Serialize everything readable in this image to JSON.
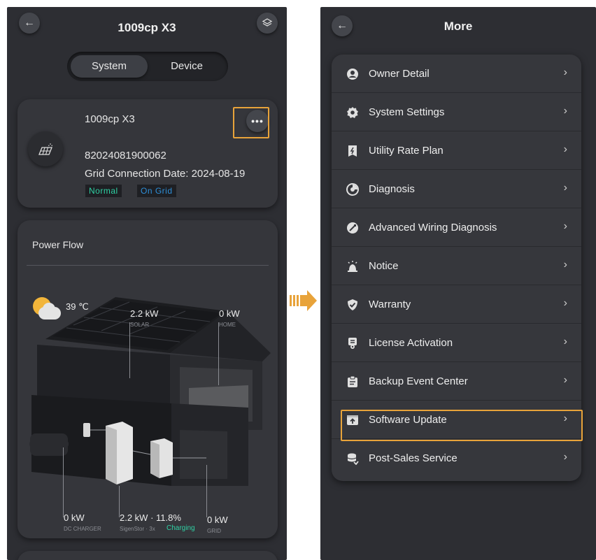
{
  "left": {
    "header": {
      "title": "1009cp X3"
    },
    "tabs": [
      {
        "label": "System",
        "active": true
      },
      {
        "label": "Device",
        "active": false
      }
    ],
    "system_card": {
      "name": "1009cp X3",
      "serial": "82024081900062",
      "grid_connection": "Grid Connection Date: 2024-08-19",
      "status_normal": "Normal",
      "status_grid": "On Grid",
      "status_colors": {
        "normal": "#2fd1a4",
        "on_grid": "#2e8fd8"
      }
    },
    "power_flow": {
      "title": "Power Flow",
      "temperature": "39 ℃",
      "solar": {
        "value": "2.2 kW",
        "label": "SOLAR"
      },
      "home": {
        "value": "0 kW",
        "label": "HOME"
      },
      "dc_charger": {
        "value": "0 kW",
        "label": "DC CHARGER"
      },
      "battery": {
        "value": "2.2 kW · 11.8%",
        "label": "SigenStor · 3x",
        "state": "Charging"
      },
      "grid": {
        "value": "0 kW",
        "label": "GRID"
      }
    }
  },
  "arrow_color": "#e8a33a",
  "right": {
    "header": {
      "title": "More"
    },
    "menu": [
      {
        "label": "Owner Detail",
        "icon": "user-icon"
      },
      {
        "label": "System Settings",
        "icon": "gear-icon"
      },
      {
        "label": "Utility Rate Plan",
        "icon": "rate-plan-icon"
      },
      {
        "label": "Diagnosis",
        "icon": "diagnosis-icon"
      },
      {
        "label": "Advanced Wiring Diagnosis",
        "icon": "wiring-icon"
      },
      {
        "label": "Notice",
        "icon": "bell-icon"
      },
      {
        "label": "Warranty",
        "icon": "shield-check-icon"
      },
      {
        "label": "License Activation",
        "icon": "license-icon"
      },
      {
        "label": "Backup Event Center",
        "icon": "clipboard-icon"
      },
      {
        "label": "Software Update",
        "icon": "upload-icon",
        "highlighted": true
      },
      {
        "label": "Post-Sales Service",
        "icon": "service-icon"
      }
    ]
  }
}
